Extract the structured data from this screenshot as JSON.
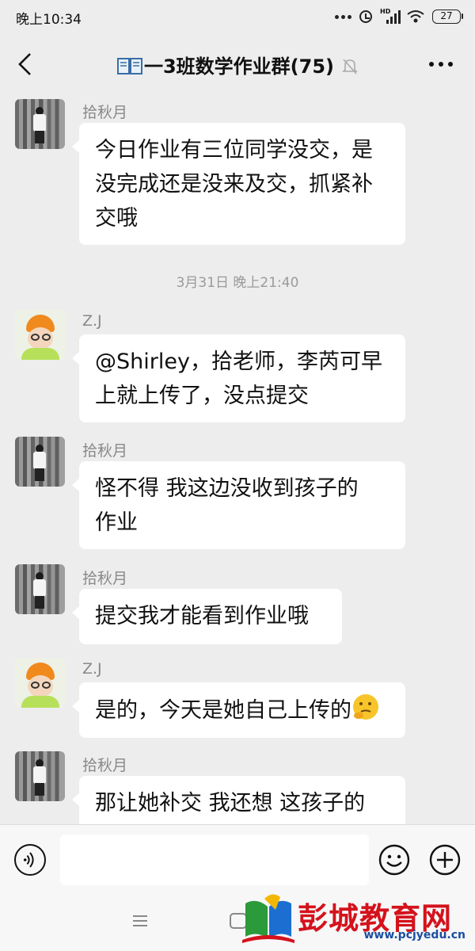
{
  "status_bar": {
    "time": "晚上10:34",
    "network_label": "HD",
    "battery": "27"
  },
  "header": {
    "title_icon": "book-icon",
    "title": "一3班数学作业群(75)"
  },
  "messages": [
    {
      "sender": "拾秋月",
      "avatar": "girl",
      "text": "今日作业有三位同学没交，是\n没完成还是没来及交，抓紧补\n交哦"
    },
    {
      "sender": "Z.J",
      "avatar": "kid",
      "text": "@Shirley，拾老师，李芮可早\n上就上传了，没点提交"
    },
    {
      "sender": "拾秋月",
      "avatar": "girl",
      "text": "怪不得 我这边没收到孩子的\n作业"
    },
    {
      "sender": "拾秋月",
      "avatar": "girl",
      "text": "提交我才能看到作业哦"
    },
    {
      "sender": "Z.J",
      "avatar": "kid",
      "text": "是的，今天是她自己上传的",
      "emoji": "thinking-face"
    },
    {
      "sender": "拾秋月",
      "avatar": "girl",
      "text": "那让她补交 我还想 这孩子的"
    }
  ],
  "timestamp": "3月31日 晚上21:40",
  "input": {
    "value": ""
  },
  "watermark": {
    "name": "彭城教育网",
    "url": "www.pcjyedu.cn"
  },
  "colors": {
    "background": "#ededed",
    "bubble": "#ffffff",
    "watermark_red": "#d4121c",
    "watermark_blue": "#1b4ea0"
  }
}
